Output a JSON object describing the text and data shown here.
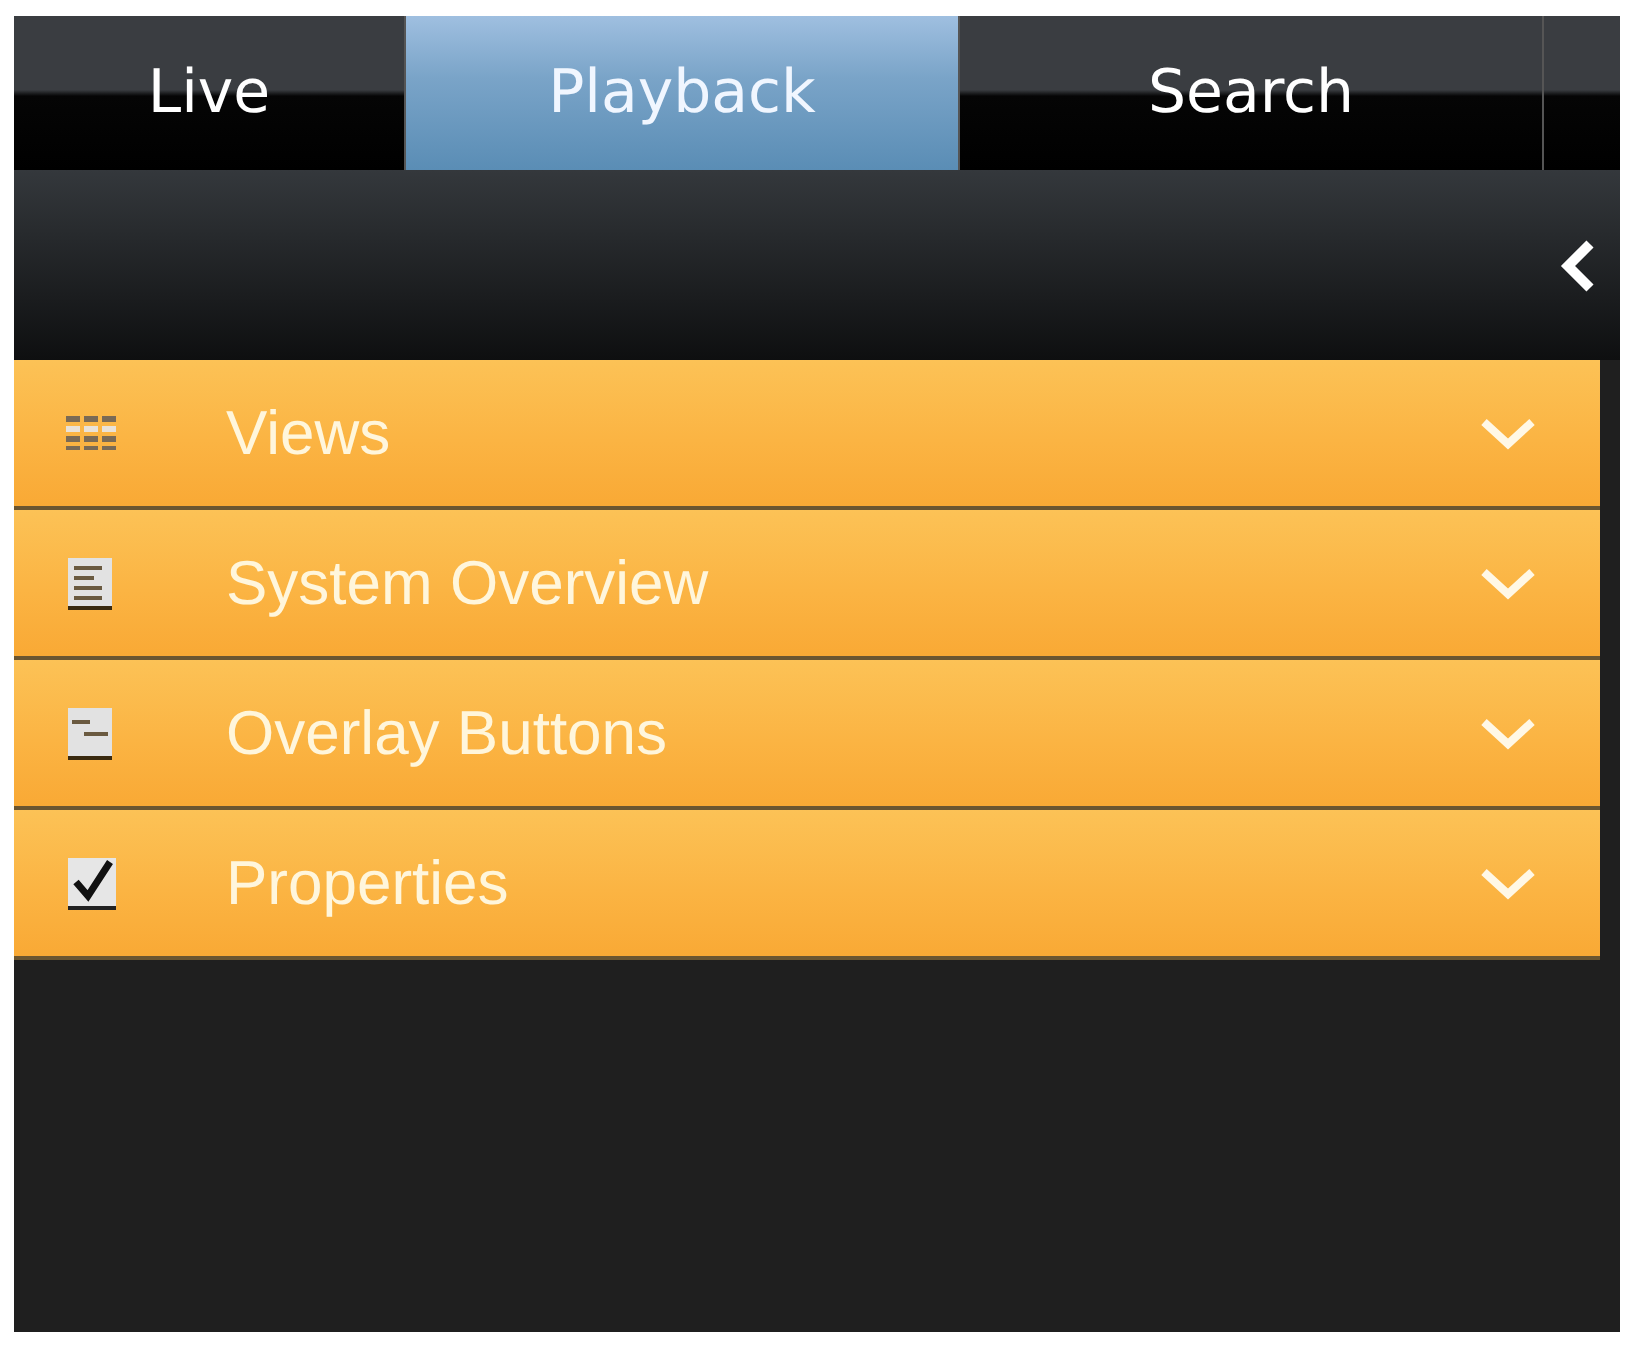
{
  "tabs": [
    {
      "label": "Live",
      "selected": false
    },
    {
      "label": "Playback",
      "selected": true
    },
    {
      "label": "Search",
      "selected": false
    }
  ],
  "panels": [
    {
      "title": "Views",
      "expanded": false
    },
    {
      "title": "System Overview",
      "expanded": false
    },
    {
      "title": "Overlay Buttons",
      "expanded": false
    },
    {
      "title": "Properties",
      "expanded": false
    }
  ]
}
